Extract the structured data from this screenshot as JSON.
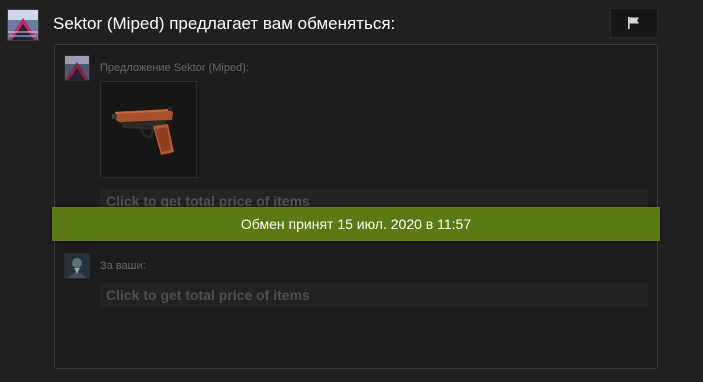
{
  "header": {
    "title": "Sektor (Miped) предлагает вам обменяться:",
    "flag_icon": "flag-icon"
  },
  "offer": {
    "their_label": "Предложение Sektor (Miped):",
    "their_item_icon": "pistol-icon",
    "their_price_text": "Click to get total price of items",
    "your_label": "За ваши:",
    "your_price_text": "Click to get total price of items"
  },
  "status": {
    "text": "Обмен принят 15 июл. 2020 в 11:57",
    "color": "#5b7a13"
  },
  "colors": {
    "background": "#202020",
    "panel": "#1c1c1c",
    "accent_green": "#5b7a13"
  }
}
